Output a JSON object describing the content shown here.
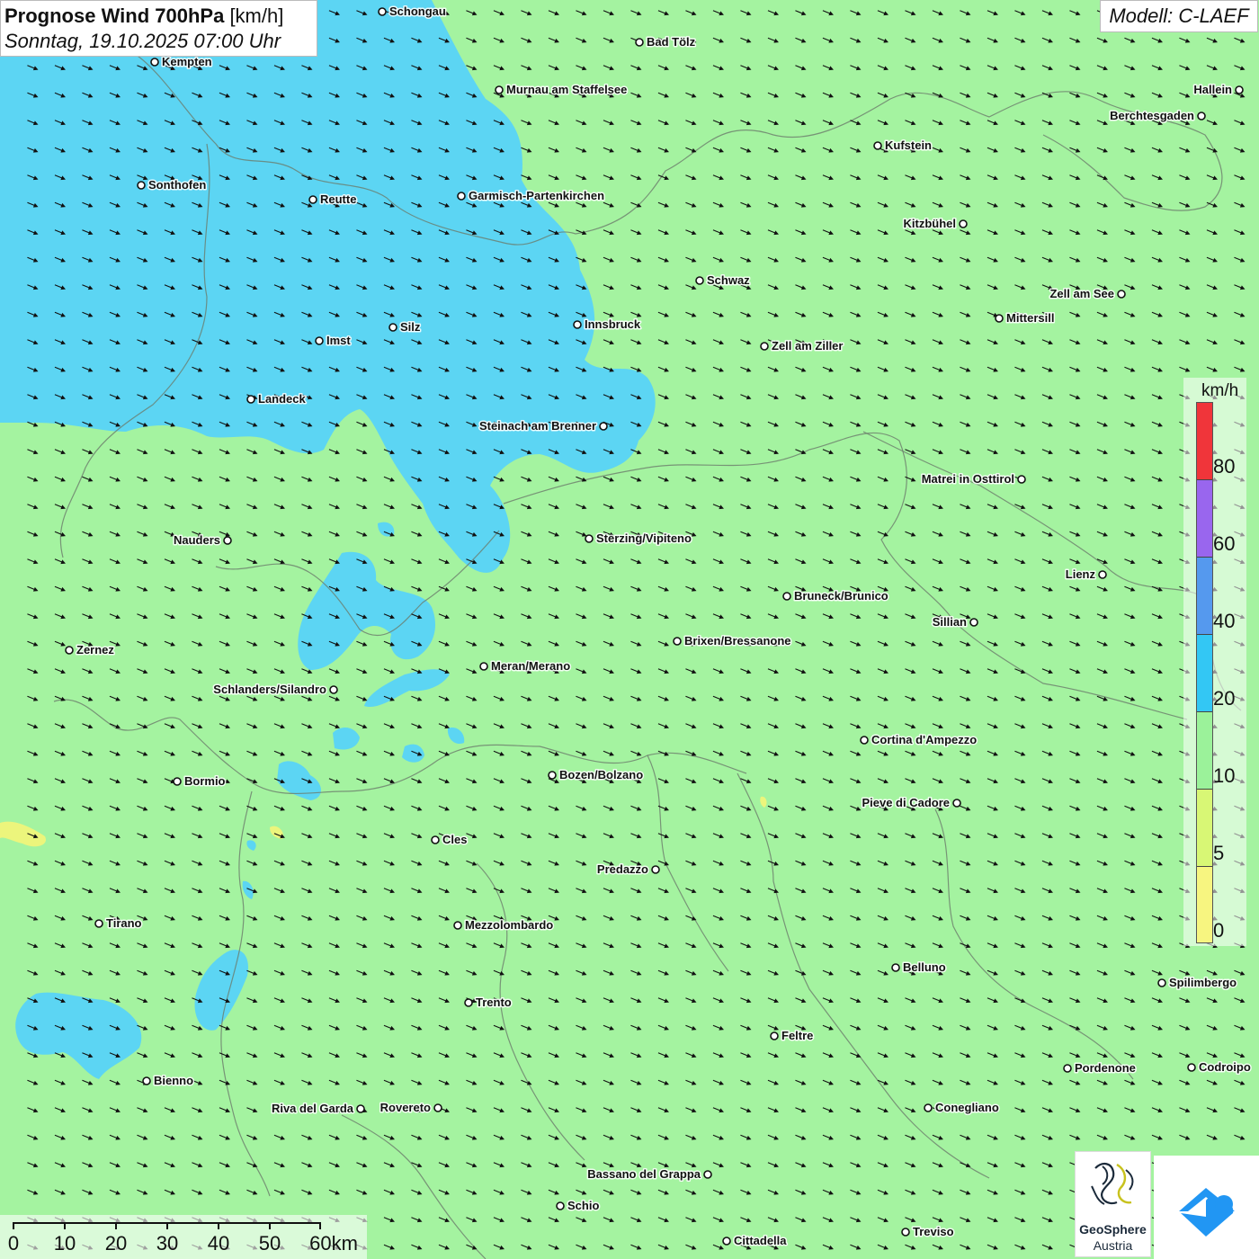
{
  "header": {
    "title_main": "Prognose Wind 700hPa",
    "title_unit": "[km/h]",
    "subtitle": "Sonntag, 19.10.2025 07:00 Uhr"
  },
  "model": {
    "label": "Modell: C-LAEF"
  },
  "legend": {
    "unit": "km/h",
    "ticks": [
      "80",
      "60",
      "40",
      "20",
      "10",
      "5",
      "0"
    ],
    "colors": {
      "c80plus": "#f0353a",
      "c60_80": "#9966ee",
      "c40_60": "#5599ee",
      "c20_40": "#33c7f4",
      "c10_20": "#9bf29a",
      "c5_10": "#d8f775",
      "c0_5": "#f7f580"
    }
  },
  "scalebar": {
    "labels": [
      "0",
      "10",
      "20",
      "30",
      "40",
      "50",
      "60km"
    ]
  },
  "map": {
    "background_color": "#a4f3a0",
    "strong_wind_color": "#58d3f8",
    "weak_wind_color": "#ecf57c",
    "arrow_color": "#111111",
    "border_color": "#6c7c6c",
    "cities": [
      {
        "id": "schongau",
        "name": "Schongau"
      },
      {
        "id": "bad-toelz",
        "name": "Bad Tölz"
      },
      {
        "id": "kempten",
        "name": "Kempten"
      },
      {
        "id": "murnau",
        "name": "Murnau am Staffelsee"
      },
      {
        "id": "hallein",
        "name": "Hallein"
      },
      {
        "id": "berchtesgaden",
        "name": "Berchtesgaden"
      },
      {
        "id": "kufstein",
        "name": "Kufstein"
      },
      {
        "id": "sonthofen",
        "name": "Sonthofen"
      },
      {
        "id": "reutte",
        "name": "Reutte"
      },
      {
        "id": "garmisch",
        "name": "Garmisch-Partenkirchen"
      },
      {
        "id": "kitzbuehel",
        "name": "Kitzbühel"
      },
      {
        "id": "schwaz",
        "name": "Schwaz"
      },
      {
        "id": "zell-am-see",
        "name": "Zell am See"
      },
      {
        "id": "mittersill",
        "name": "Mittersill"
      },
      {
        "id": "innsbruck",
        "name": "Innsbruck"
      },
      {
        "id": "silz",
        "name": "Silz"
      },
      {
        "id": "imst",
        "name": "Imst"
      },
      {
        "id": "zell-am-ziller",
        "name": "Zell am Ziller"
      },
      {
        "id": "landeck",
        "name": "Landeck"
      },
      {
        "id": "steinach",
        "name": "Steinach am Brenner"
      },
      {
        "id": "matrei",
        "name": "Matrei in Osttirol"
      },
      {
        "id": "nauders",
        "name": "Nauders"
      },
      {
        "id": "sterzing",
        "name": "Sterzing/Vipiteno"
      },
      {
        "id": "lienz",
        "name": "Lienz"
      },
      {
        "id": "bruneck",
        "name": "Bruneck/Brunico"
      },
      {
        "id": "sillian",
        "name": "Sillian"
      },
      {
        "id": "zernez",
        "name": "Zernez"
      },
      {
        "id": "brixen",
        "name": "Brixen/Bressanone"
      },
      {
        "id": "meran",
        "name": "Meran/Merano"
      },
      {
        "id": "schlanders",
        "name": "Schlanders/Silandro"
      },
      {
        "id": "cortina",
        "name": "Cortina d'Ampezzo"
      },
      {
        "id": "bormio",
        "name": "Bormio"
      },
      {
        "id": "bozen",
        "name": "Bozen/Bolzano"
      },
      {
        "id": "pieve",
        "name": "Pieve di Cadore"
      },
      {
        "id": "cles",
        "name": "Cles"
      },
      {
        "id": "predazzo",
        "name": "Predazzo"
      },
      {
        "id": "tirano",
        "name": "Tirano"
      },
      {
        "id": "mezzolombardo",
        "name": "Mezzolombardo"
      },
      {
        "id": "belluno",
        "name": "Belluno"
      },
      {
        "id": "spilimbergo",
        "name": "Spilimbergo"
      },
      {
        "id": "trento",
        "name": "Trento"
      },
      {
        "id": "feltre",
        "name": "Feltre"
      },
      {
        "id": "bienno",
        "name": "Bienno"
      },
      {
        "id": "pordenone",
        "name": "Pordenone"
      },
      {
        "id": "codroipo",
        "name": "Codroipo"
      },
      {
        "id": "riva",
        "name": "Riva del Garda"
      },
      {
        "id": "rovereto",
        "name": "Rovereto"
      },
      {
        "id": "conegliano",
        "name": "Conegliano"
      },
      {
        "id": "bassano",
        "name": "Bassano del Grappa"
      },
      {
        "id": "schio",
        "name": "Schio"
      },
      {
        "id": "treviso",
        "name": "Treviso"
      },
      {
        "id": "cittadella",
        "name": "Cittadella"
      }
    ]
  },
  "logos": {
    "geosphere_name": "GeoSphere",
    "geosphere_sub": "Austria",
    "geosphere_colors": {
      "dark": "#1b2a3a",
      "accent": "#c8c21e"
    },
    "app_color": "#2196f3"
  }
}
